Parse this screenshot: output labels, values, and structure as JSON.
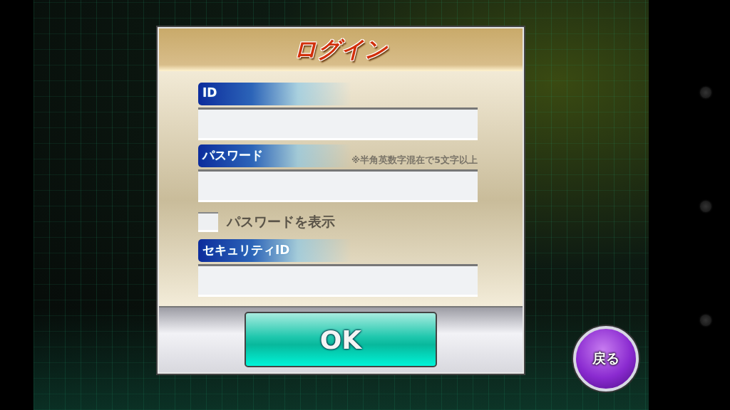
{
  "dialog": {
    "title": "ログイン",
    "rows": [
      {
        "kind": "input",
        "label": "ID"
      },
      {
        "kind": "input",
        "label": "パスワード",
        "note": "※半角英数字混在で5文字以上"
      },
      {
        "kind": "checkbox",
        "label": "パスワードを表示",
        "checked": false
      },
      {
        "kind": "input",
        "label": "セキュリティID"
      }
    ],
    "ok_button": "OK"
  },
  "back_button": "戻る"
}
